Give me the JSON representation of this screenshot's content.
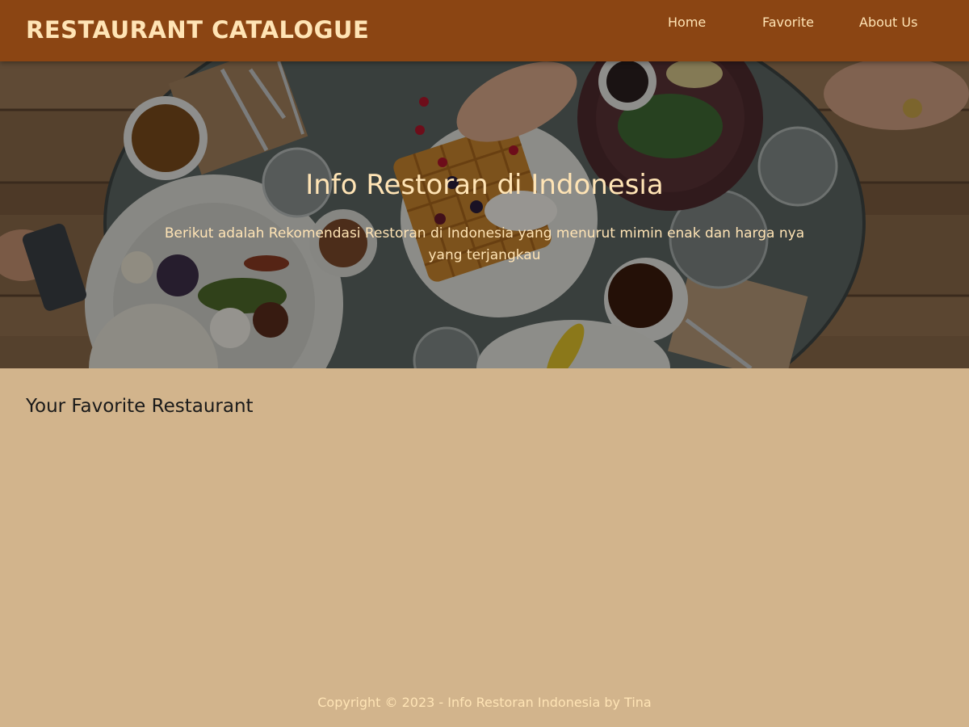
{
  "header": {
    "brand": "RESTAURANT CATALOGUE",
    "nav": {
      "home": "Home",
      "favorite": "Favorite",
      "about": "About Us"
    }
  },
  "hero": {
    "title": "Info Restoran di Indonesia",
    "subtitle": "Berikut adalah Rekomendasi Restoran di Indonesia yang menurut mimin enak dan harga nya yang terjangkau",
    "image": "dining-table-photo"
  },
  "main": {
    "section_title": "Your Favorite Restaurant",
    "restaurants": []
  },
  "footer": {
    "copyright": "Copyright © 2023 - Info Restoran Indonesia by Tina"
  },
  "colors": {
    "app_bar": "#8b4513",
    "accent_text": "#ffe4b5",
    "page_background": "#d2b48c"
  }
}
